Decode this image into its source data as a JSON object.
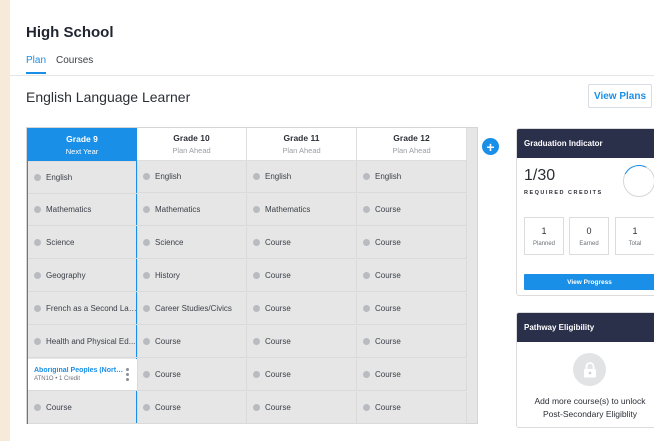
{
  "header": {
    "title": "High School",
    "tabs": [
      {
        "label": "Plan"
      },
      {
        "label": "Courses"
      }
    ]
  },
  "page": {
    "title": "English Language Learner",
    "view_plans_label": "View Plans"
  },
  "plan": {
    "columns": [
      {
        "grade": "Grade 9",
        "subtitle": "Next Year",
        "cells": [
          "English",
          "Mathematics",
          "Science",
          "Geography",
          "French as a Second Lan...",
          "Health and Physical Ed...",
          "",
          "Course"
        ],
        "course": {
          "title": "Aboriginal Peoples (North ...",
          "subtitle": "ATN1O • 1 Credit"
        }
      },
      {
        "grade": "Grade 10",
        "subtitle": "Plan Ahead",
        "cells": [
          "English",
          "Mathematics",
          "Science",
          "History",
          "Career Studies/Civics",
          "Course",
          "Course",
          "Course"
        ]
      },
      {
        "grade": "Grade 11",
        "subtitle": "Plan Ahead",
        "cells": [
          "English",
          "Mathematics",
          "Course",
          "Course",
          "Course",
          "Course",
          "Course",
          "Course"
        ]
      },
      {
        "grade": "Grade 12",
        "subtitle": "Plan Ahead",
        "cells": [
          "English",
          "Course",
          "Course",
          "Course",
          "Course",
          "Course",
          "Course",
          "Course"
        ]
      }
    ],
    "add_icon": "plus-icon"
  },
  "graduation": {
    "title": "Graduation Indicator",
    "credits": "1/30",
    "credits_label": "REQUIRED CREDITS",
    "progress_fraction": 0.033,
    "stats": [
      {
        "value": "1",
        "label": "Planned"
      },
      {
        "value": "0",
        "label": "Earned"
      },
      {
        "value": "1",
        "label": "Total"
      }
    ],
    "button_label": "View Progress"
  },
  "pathway": {
    "title": "Pathway Eligibility",
    "icon": "lock-icon",
    "message_line1": "Add more course(s) to unlock",
    "message_line2": "Post-Secondary Eligiblity"
  },
  "colors": {
    "accent": "#1a8fe8",
    "panel_header": "#2a2f4a",
    "background": "#f7ead8"
  }
}
